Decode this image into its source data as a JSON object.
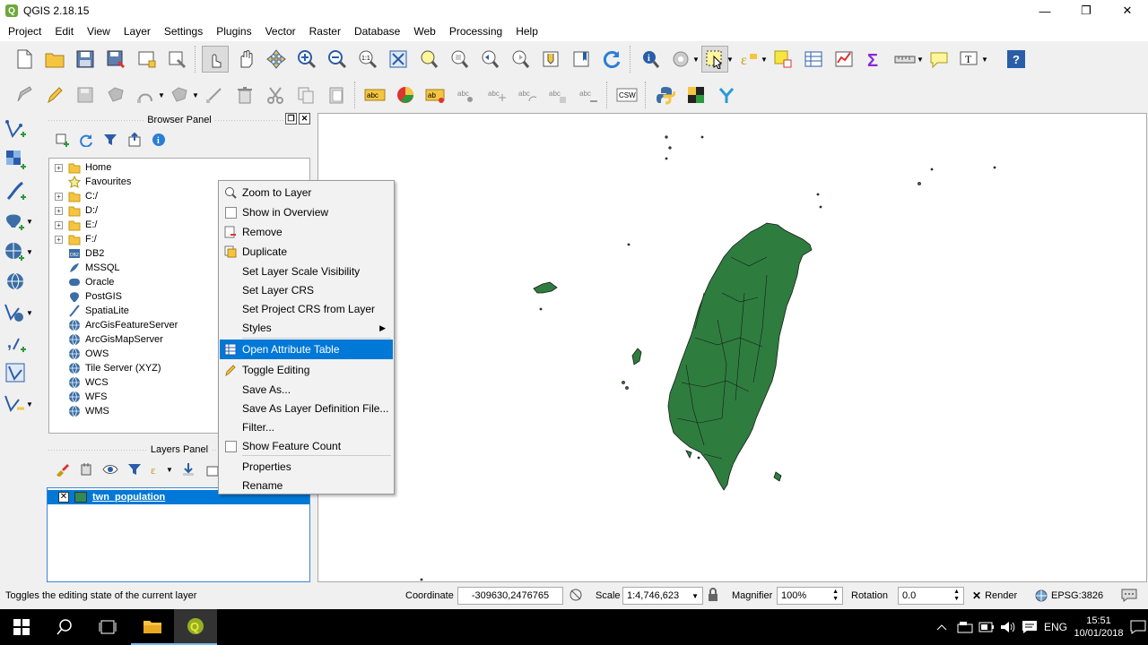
{
  "window": {
    "title": "QGIS 2.18.15",
    "minimize": "—",
    "maximize": "❐",
    "close": "✕"
  },
  "menu": [
    "Project",
    "Edit",
    "View",
    "Layer",
    "Settings",
    "Plugins",
    "Vector",
    "Raster",
    "Database",
    "Web",
    "Processing",
    "Help"
  ],
  "browser_panel": {
    "title": "Browser Panel",
    "items": [
      {
        "label": "Home",
        "icon": "folder-icon",
        "expandable": true
      },
      {
        "label": "Favourites",
        "icon": "star-icon",
        "expandable": false
      },
      {
        "label": "C:/",
        "icon": "folder-icon",
        "expandable": true
      },
      {
        "label": "D:/",
        "icon": "folder-icon",
        "expandable": true
      },
      {
        "label": "E:/",
        "icon": "folder-icon",
        "expandable": true
      },
      {
        "label": "F:/",
        "icon": "folder-icon",
        "expandable": true
      },
      {
        "label": "DB2",
        "icon": "db2-icon",
        "expandable": false
      },
      {
        "label": "MSSQL",
        "icon": "mssql-icon",
        "expandable": false
      },
      {
        "label": "Oracle",
        "icon": "oracle-icon",
        "expandable": false
      },
      {
        "label": "PostGIS",
        "icon": "postgis-icon",
        "expandable": false
      },
      {
        "label": "SpatiaLite",
        "icon": "spatialite-icon",
        "expandable": false
      },
      {
        "label": "ArcGisFeatureServer",
        "icon": "globe-icon",
        "expandable": false
      },
      {
        "label": "ArcGisMapServer",
        "icon": "globe-icon",
        "expandable": false
      },
      {
        "label": "OWS",
        "icon": "globe-icon",
        "expandable": false
      },
      {
        "label": "Tile Server (XYZ)",
        "icon": "globe-icon",
        "expandable": false
      },
      {
        "label": "WCS",
        "icon": "globe-icon",
        "expandable": false
      },
      {
        "label": "WFS",
        "icon": "globe-icon",
        "expandable": false
      },
      {
        "label": "WMS",
        "icon": "globe-icon",
        "expandable": false
      }
    ]
  },
  "layers_panel": {
    "title": "Layers Panel",
    "layer": {
      "name": "twn_population",
      "checked": true,
      "color": "#2f8a55"
    }
  },
  "context_menu": {
    "items": [
      {
        "label": "Zoom to Layer",
        "icon": "zoom-icon"
      },
      {
        "label": "Show in Overview",
        "icon": "checkbox-icon"
      },
      {
        "label": "Remove",
        "icon": "remove-icon"
      },
      {
        "label": "Duplicate",
        "icon": "duplicate-icon"
      },
      {
        "label": "Set Layer Scale Visibility",
        "icon": ""
      },
      {
        "label": "Set Layer CRS",
        "icon": ""
      },
      {
        "label": "Set Project CRS from Layer",
        "icon": ""
      },
      {
        "label": "Styles",
        "icon": "",
        "submenu": true
      },
      {
        "label": "Open Attribute Table",
        "icon": "table-icon",
        "highlighted": true
      },
      {
        "label": "Toggle Editing",
        "icon": "pencil-icon"
      },
      {
        "label": "Save As...",
        "icon": ""
      },
      {
        "label": "Save As Layer Definition File...",
        "icon": ""
      },
      {
        "label": "Filter...",
        "icon": ""
      },
      {
        "label": "Show Feature Count",
        "icon": "checkbox-icon"
      },
      {
        "label": "Properties",
        "icon": ""
      },
      {
        "label": "Rename",
        "icon": ""
      }
    ]
  },
  "statusbar": {
    "message": "Toggles the editing state of the current layer",
    "coordinate_label": "Coordinate",
    "coordinate": "-309630,2476765",
    "scale_label": "Scale",
    "scale": "1:4,746,623",
    "magnifier_label": "Magnifier",
    "magnifier": "100%",
    "rotation_label": "Rotation",
    "rotation": "0.0",
    "render_label": "Render",
    "crs": "EPSG:3826"
  },
  "taskbar": {
    "lang": "ENG",
    "time": "15:51",
    "date": "10/01/2018"
  },
  "colors": {
    "map_fill": "#2e7d3f",
    "highlight": "#0078d7"
  }
}
